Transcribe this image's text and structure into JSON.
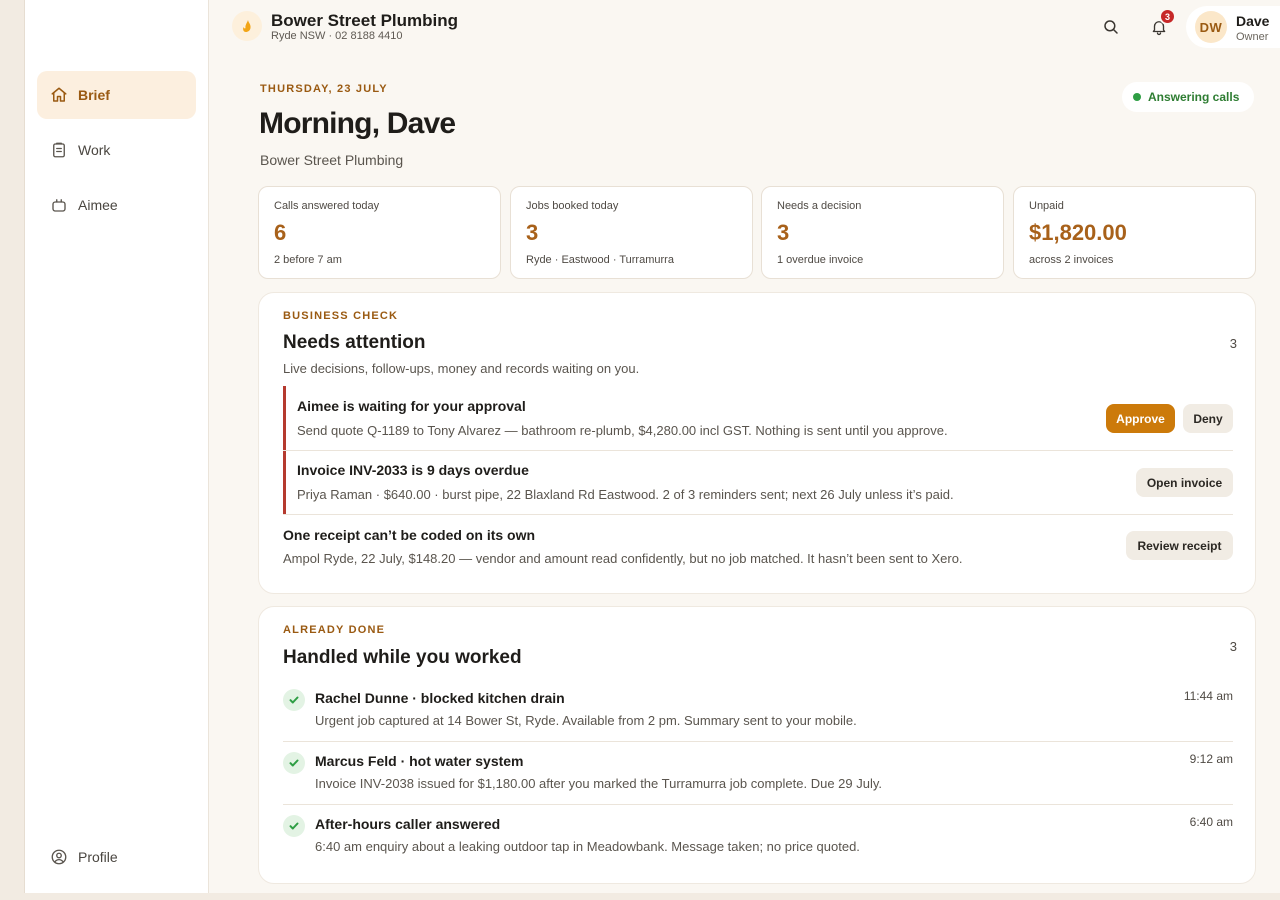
{
  "sidebar": {
    "items": [
      {
        "label": "Brief",
        "icon": "home-icon"
      },
      {
        "label": "Work",
        "icon": "clipboard-icon"
      },
      {
        "label": "Aimee",
        "icon": "assistant-icon"
      }
    ],
    "profile": {
      "label": "Profile",
      "icon": "user-circle-icon"
    }
  },
  "header": {
    "business_name": "Bower Street Plumbing",
    "business_sub": "Ryde NSW · 02 8188 4410",
    "notification_count": "3",
    "user": {
      "initials": "DW",
      "name": "Dave",
      "role": "Owner"
    }
  },
  "brief": {
    "date": "THURSDAY, 23 JULY",
    "greeting": "Morning, Dave",
    "business": "Bower Street Plumbing",
    "status": "Answering calls",
    "status_color": "#2e9e44"
  },
  "stats": [
    {
      "label": "Calls answered today",
      "value": "6",
      "note": "2 before 7 am"
    },
    {
      "label": "Jobs booked today",
      "value": "3",
      "note": "Ryde · Eastwood · Turramurra"
    },
    {
      "label": "Needs a decision",
      "value": "3",
      "note": "1 overdue invoice"
    },
    {
      "label": "Unpaid",
      "value": "$1,820.00",
      "note": "across 2 invoices"
    }
  ],
  "attention": {
    "eyebrow": "BUSINESS CHECK",
    "title": "Needs attention",
    "count": "3",
    "description": "Live decisions, follow-ups, money and records waiting on you.",
    "items": [
      {
        "title": "Aimee is waiting for your approval",
        "text": "Send quote Q-1189 to Tony Alvarez — bathroom re-plumb, $4,280.00 incl GST. Nothing is sent until you approve.",
        "actions": [
          "Approve",
          "Deny"
        ]
      },
      {
        "title": "Invoice INV-2033 is 9 days overdue",
        "text": "Priya Raman · $640.00 · burst pipe, 22 Blaxland Rd Eastwood. 2 of 3 reminders sent; next 26 July unless it’s paid.",
        "actions": [
          "Open invoice"
        ]
      },
      {
        "title": "One receipt can’t be coded on its own",
        "text": "Ampol Ryde, 22 July, $148.20 — vendor and amount read confidently, but no job matched. It hasn’t been sent to Xero.",
        "actions": [
          "Review receipt"
        ]
      }
    ]
  },
  "done": {
    "eyebrow": "ALREADY DONE",
    "title": "Handled while you worked",
    "count": "3",
    "items": [
      {
        "title": "Rachel Dunne · blocked kitchen drain",
        "text": "Urgent job captured at 14 Bower St, Ryde. Available from 2 pm. Summary sent to your mobile.",
        "time": "11:44 am"
      },
      {
        "title": "Marcus Feld · hot water system",
        "text": "Invoice INV-2038 issued for $1,180.00 after you marked the Turramurra job complete. Due 29 July.",
        "time": "9:12 am"
      },
      {
        "title": "After-hours caller answered",
        "text": "6:40 am enquiry about a leaking outdoor tap in Meadowbank. Message taken; no price quoted.",
        "time": "6:40 am"
      }
    ]
  },
  "colors": {
    "accent": "#cc7a0a",
    "accent_text": "#9a5a12",
    "alert": "#b53a2f",
    "success": "#2e9e44"
  }
}
